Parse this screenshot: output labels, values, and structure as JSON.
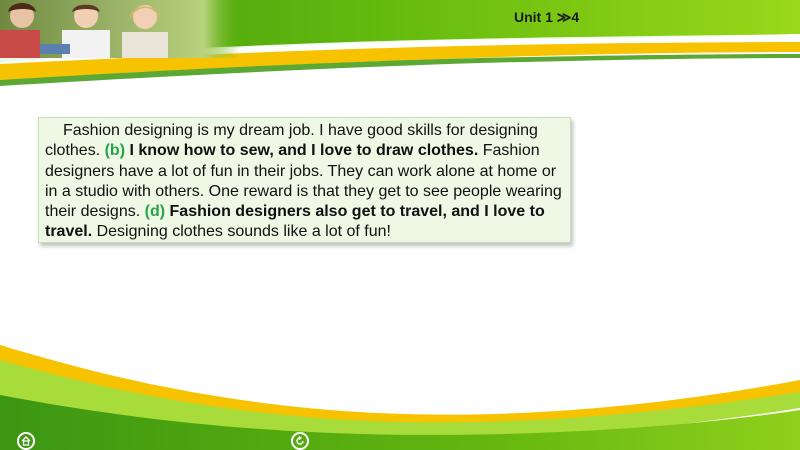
{
  "header": {
    "unit_label": "Unit 1 ≫4"
  },
  "passage": {
    "s1": "Fashion designing is my dream job. I have good skills for designing clothes.",
    "marker_b": "(b)",
    "bold_b": "I know how to sew, and I love to draw clothes.",
    "s2": "Fashion designers have a lot of fun in their jobs. They can work alone at home or in a studio with others. One reward is that they get to see people wearing their designs.",
    "marker_d": "(d)",
    "bold_d": "Fashion designers also get to travel, and I love to travel.",
    "s3": "Designing clothes sounds like a lot of fun!"
  },
  "footer": {
    "home_icon": "home-icon",
    "back_icon": "return-icon"
  },
  "colors": {
    "green": "#5fb30c",
    "light_green": "#8fd22a",
    "yellow": "#f7c300",
    "box_bg": "#eef8e4",
    "marker": "#27a34a"
  }
}
